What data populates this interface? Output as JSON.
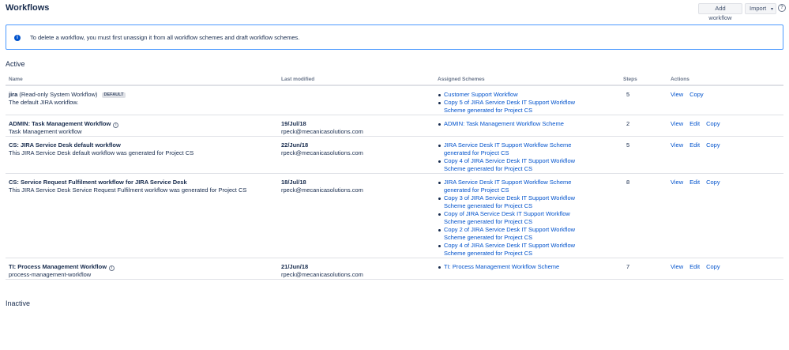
{
  "header": {
    "title": "Workflows",
    "add_label": "Add workflow",
    "import_label": "Import",
    "caret": "▾",
    "help": "?"
  },
  "info": {
    "icon": "i",
    "text": "To delete a workflow, you must first unassign it from all workflow schemes and draft workflow schemes."
  },
  "sections": {
    "active": "Active",
    "inactive": "Inactive"
  },
  "columns": {
    "name": "Name",
    "modified": "Last modified",
    "schemes": "Assigned Schemes",
    "steps": "Steps",
    "actions": "Actions"
  },
  "rows": [
    {
      "name": "jira",
      "name_suffix": "(Read-only System Workflow)",
      "badge": "DEFAULT",
      "description": "The default JIRA workflow.",
      "date": "",
      "user": "",
      "schemes": [
        "Customer Support Workflow",
        "Copy 5 of JIRA Service Desk IT Support Workflow Scheme generated for Project CS"
      ],
      "steps": "5",
      "actions": [
        "View",
        "Copy"
      ]
    },
    {
      "name": "ADMIN: Task Management Workflow",
      "description": "Task Management workflow",
      "date": "19/Jul/18",
      "user": "rpeck@mecanicasolutions.com",
      "schemes": [
        "ADMIN: Task Management Workflow Scheme"
      ],
      "steps": "2",
      "actions": [
        "View",
        "Edit",
        "Copy"
      ]
    },
    {
      "name": "CS: JIRA Service Desk default workflow",
      "description": "This JIRA Service Desk default workflow was generated for Project CS",
      "date": "22/Jun/18",
      "user": "rpeck@mecanicasolutions.com",
      "schemes": [
        "JIRA Service Desk IT Support Workflow Scheme generated for Project CS",
        "Copy 4 of JIRA Service Desk IT Support Workflow Scheme generated for Project CS"
      ],
      "steps": "5",
      "actions": [
        "View",
        "Edit",
        "Copy"
      ]
    },
    {
      "name": "CS: Service Request Fulfilment workflow for JIRA Service Desk",
      "description": "This JIRA Service Desk Service Request Fulfilment workflow was generated for Project CS",
      "date": "18/Jul/18",
      "user": "rpeck@mecanicasolutions.com",
      "schemes": [
        "JIRA Service Desk IT Support Workflow Scheme generated for Project CS",
        "Copy 3 of JIRA Service Desk IT Support Workflow Scheme generated for Project CS",
        "Copy of JIRA Service Desk IT Support Workflow Scheme generated for Project CS",
        "Copy 2 of JIRA Service Desk IT Support Workflow Scheme generated for Project CS",
        "Copy 4 of JIRA Service Desk IT Support Workflow Scheme generated for Project CS"
      ],
      "steps": "8",
      "actions": [
        "View",
        "Edit",
        "Copy"
      ]
    },
    {
      "name": "TI: Process Management Workflow",
      "description": "process-management-workflow",
      "date": "21/Jun/18",
      "user": "rpeck@mecanicasolutions.com",
      "schemes": [
        "TI: Process Management Workflow Scheme"
      ],
      "steps": "7",
      "actions": [
        "View",
        "Edit",
        "Copy"
      ]
    }
  ]
}
